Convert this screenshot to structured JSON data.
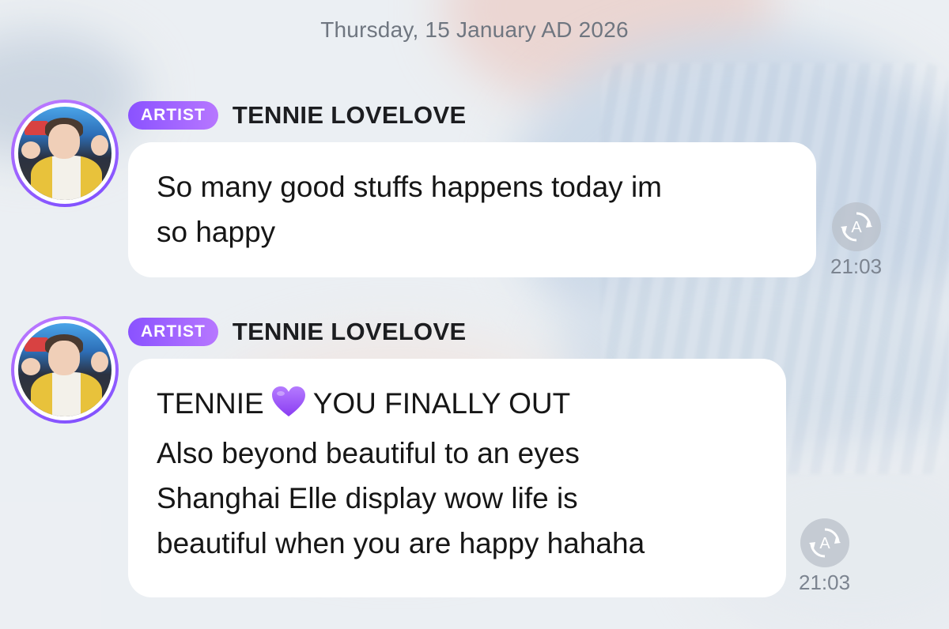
{
  "date_separator": "Thursday, 15 January AD 2026",
  "messages": [
    {
      "badge": "ARTIST",
      "author": "TENNIE LOVELOVE",
      "lines": [
        "So many good stuffs happens today im",
        "so happy"
      ],
      "time": "21:03",
      "translate_icon": "auto-translate-icon"
    },
    {
      "badge": "ARTIST",
      "author": "TENNIE LOVELOVE",
      "first_line_before": "TENNIE",
      "first_line_emoji": "purple-heart-icon",
      "first_line_after": "YOU FINALLY OUT",
      "lines": [
        "Also beyond beautiful to an eyes",
        "Shanghai Elle display wow life is",
        "beautiful when you are happy hahaha"
      ],
      "time": "21:03",
      "translate_icon": "auto-translate-icon"
    }
  ],
  "colors": {
    "badge_gradient_start": "#8a52ff",
    "badge_gradient_end": "#b777ff",
    "bubble": "#ffffff",
    "heart": "#9b4dff"
  }
}
